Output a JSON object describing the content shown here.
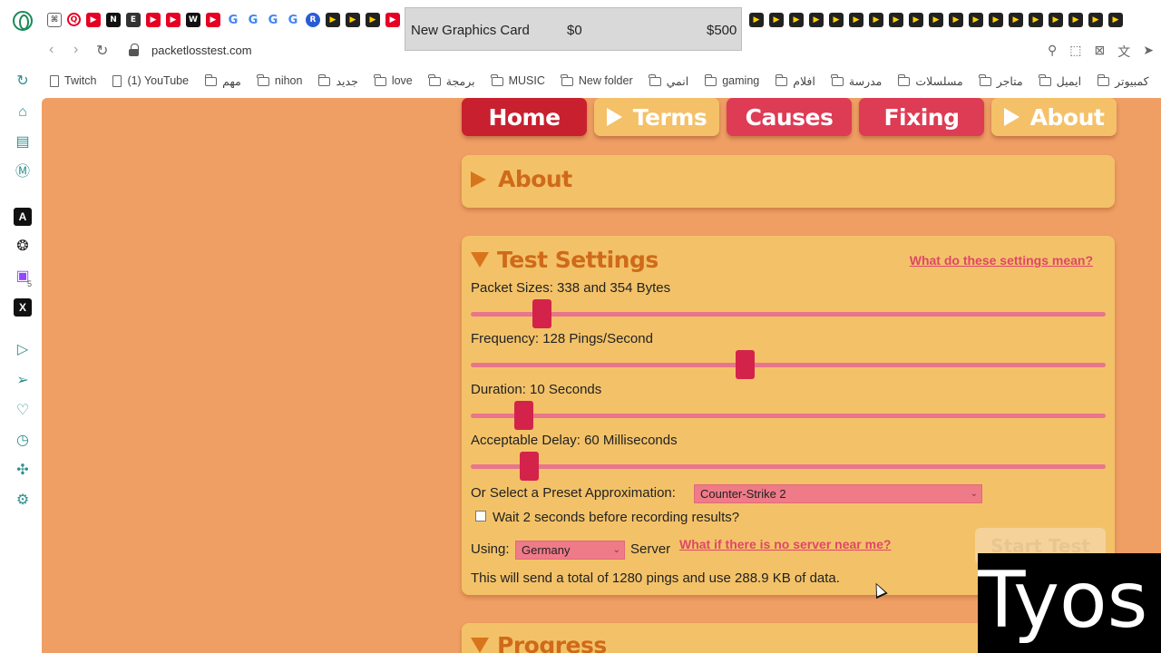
{
  "browser": {
    "url": "packetlosstest.com",
    "overlay": {
      "product": "New Graphics Card",
      "price_min": "$0",
      "price_max": "$500"
    },
    "bookmarks": [
      {
        "label": "Twitch",
        "icon": "doc"
      },
      {
        "label": "(1) YouTube",
        "icon": "doc"
      },
      {
        "label": "مهم",
        "icon": "folder"
      },
      {
        "label": "nihon",
        "icon": "folder"
      },
      {
        "label": "جديد",
        "icon": "folder"
      },
      {
        "label": "love",
        "icon": "folder"
      },
      {
        "label": "برمجة",
        "icon": "folder"
      },
      {
        "label": "MUSIC",
        "icon": "folder"
      },
      {
        "label": "New folder",
        "icon": "folder"
      },
      {
        "label": "انمي",
        "icon": "folder"
      },
      {
        "label": "gaming",
        "icon": "folder"
      },
      {
        "label": "افلام",
        "icon": "folder"
      },
      {
        "label": "مدرسة",
        "icon": "folder"
      },
      {
        "label": "مسلسلات",
        "icon": "folder"
      },
      {
        "label": "متاجر",
        "icon": "folder"
      },
      {
        "label": "ايميل",
        "icon": "folder"
      },
      {
        "label": "كمبيوتر",
        "icon": "folder"
      }
    ],
    "sidebar_badge": "5"
  },
  "nav": {
    "home": "Home",
    "terms": "Terms",
    "causes": "Causes",
    "fixing": "Fixing",
    "about": "About"
  },
  "about_panel": {
    "title": "About"
  },
  "settings": {
    "title": "Test Settings",
    "help_link": "What do these settings mean?",
    "packet_sizes_label": "Packet Sizes: 338 and 354 Bytes",
    "packet_sizes_level": 0.1,
    "frequency_label": "Frequency: 128 Pings/Second",
    "frequency_level": 0.43,
    "duration_label": "Duration: 10 Seconds",
    "duration_level": 0.07,
    "delay_label": "Acceptable Delay: 60 Milliseconds",
    "delay_level": 0.08,
    "preset_label": "Or Select a Preset Approximation:",
    "preset_value": "Counter-Strike 2",
    "wait_label": "Wait 2 seconds before recording results?",
    "using_label": "Using:",
    "server_value": "Germany",
    "server_label": "Server",
    "server_help_link": "What if there is no server near me?",
    "start_button": "Start Test",
    "summary": "This will send a total of 1280 pings and use 288.9 KB of data."
  },
  "progress_panel": {
    "title": "Progress"
  },
  "watermark": "Tyos"
}
